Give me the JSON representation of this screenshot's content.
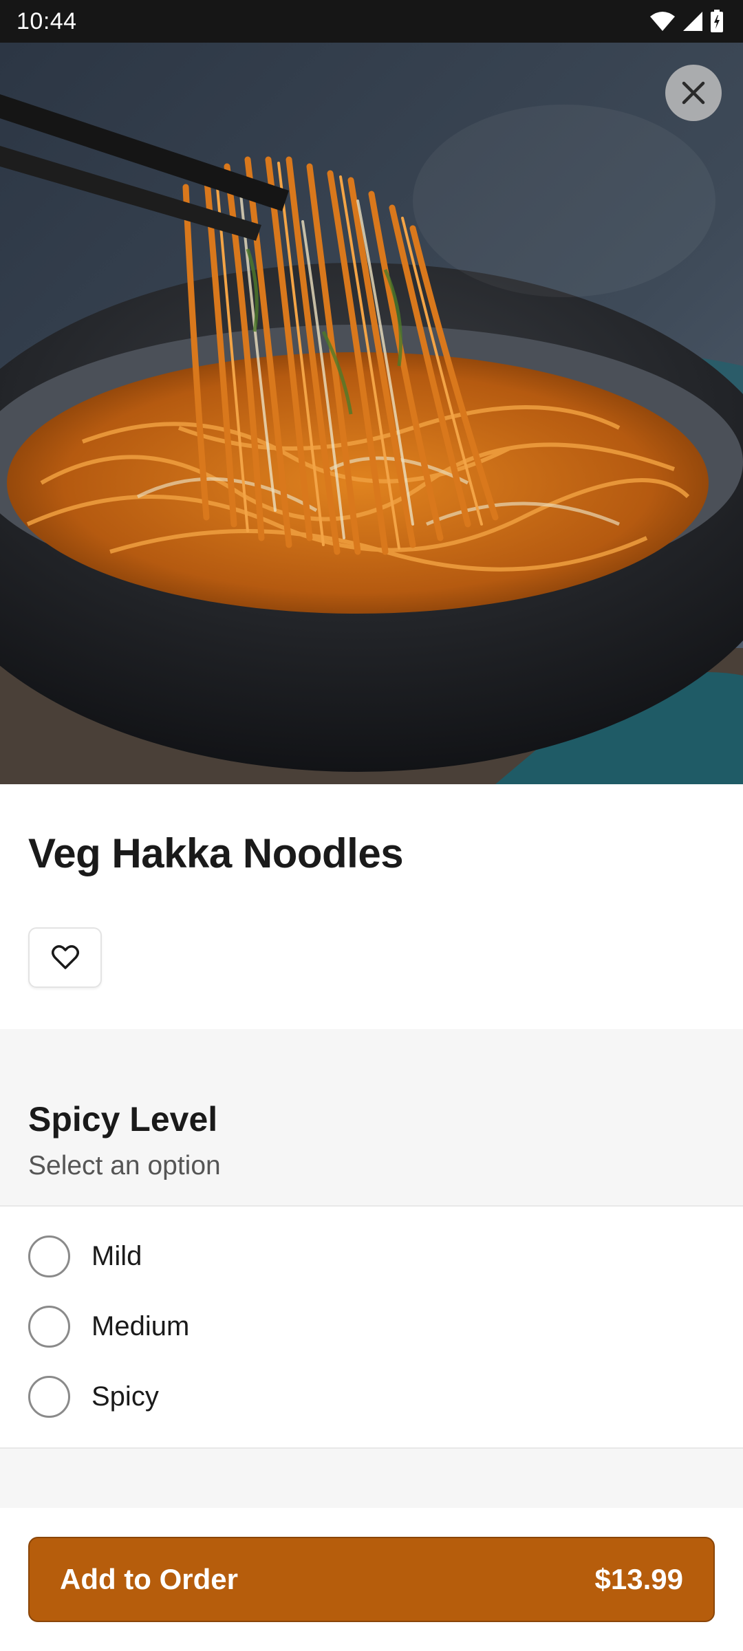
{
  "status_bar": {
    "time": "10:44",
    "icons": [
      "wifi-icon",
      "signal-icon",
      "battery-icon"
    ]
  },
  "hero": {
    "image": "noodles-photo",
    "close_icon": "close-icon"
  },
  "item": {
    "title": "Veg Hakka Noodles",
    "favorite_icon": "heart-icon"
  },
  "section": {
    "title": "Spicy Level",
    "subtitle": "Select an option",
    "options": [
      {
        "label": "Mild",
        "selected": false
      },
      {
        "label": "Medium",
        "selected": false
      },
      {
        "label": "Spicy",
        "selected": false
      }
    ]
  },
  "order_button": {
    "label": "Add to Order",
    "price": "$13.99"
  },
  "colors": {
    "accent": "#b65d0c",
    "status_bar": "#161616",
    "section_bg": "#f6f6f6"
  }
}
